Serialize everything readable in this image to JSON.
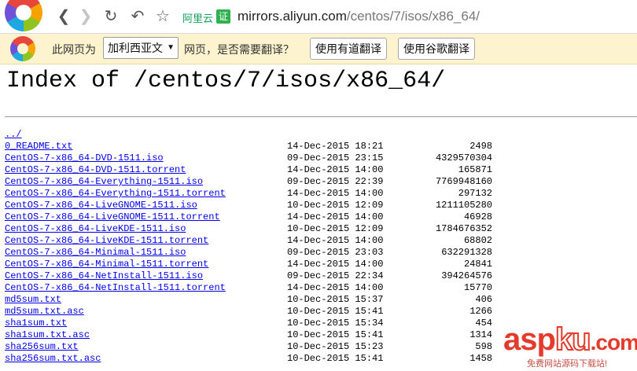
{
  "browser": {
    "url_badge": "阿里云",
    "url_host": "mirrors.aliyun.com",
    "url_path": "/centos/7/isos/x86_64/"
  },
  "translate_bar": {
    "prompt_prefix": "此网页为",
    "language": "加利西亚文",
    "prompt_suffix": "网页，是否需要翻译？",
    "youdao_button": "使用有道翻译",
    "google_button": "使用谷歌翻译"
  },
  "page": {
    "title": "Index of /centos/7/isos/x86_64/",
    "parent_link": "../",
    "entries": [
      {
        "name": "0_README.txt",
        "date": "14-Dec-2015 18:21",
        "size": "2498"
      },
      {
        "name": "CentOS-7-x86_64-DVD-1511.iso",
        "date": "09-Dec-2015 23:15",
        "size": "4329570304"
      },
      {
        "name": "CentOS-7-x86_64-DVD-1511.torrent",
        "date": "14-Dec-2015 14:00",
        "size": "165871"
      },
      {
        "name": "CentOS-7-x86_64-Everything-1511.iso",
        "date": "09-Dec-2015 22:39",
        "size": "7769948160"
      },
      {
        "name": "CentOS-7-x86_64-Everything-1511.torrent",
        "date": "14-Dec-2015 14:00",
        "size": "297132"
      },
      {
        "name": "CentOS-7-x86_64-LiveGNOME-1511.iso",
        "date": "10-Dec-2015 12:09",
        "size": "1211105280"
      },
      {
        "name": "CentOS-7-x86_64-LiveGNOME-1511.torrent",
        "date": "14-Dec-2015 14:00",
        "size": "46928"
      },
      {
        "name": "CentOS-7-x86_64-LiveKDE-1511.iso",
        "date": "10-Dec-2015 12:09",
        "size": "1784676352"
      },
      {
        "name": "CentOS-7-x86_64-LiveKDE-1511.torrent",
        "date": "14-Dec-2015 14:00",
        "size": "68802"
      },
      {
        "name": "CentOS-7-x86_64-Minimal-1511.iso",
        "date": "09-Dec-2015 23:03",
        "size": "632291328"
      },
      {
        "name": "CentOS-7-x86_64-Minimal-1511.torrent",
        "date": "14-Dec-2015 14:00",
        "size": "24841"
      },
      {
        "name": "CentOS-7-x86_64-NetInstall-1511.iso",
        "date": "09-Dec-2015 22:34",
        "size": "394264576"
      },
      {
        "name": "CentOS-7-x86_64-NetInstall-1511.torrent",
        "date": "14-Dec-2015 14:00",
        "size": "15770"
      },
      {
        "name": "md5sum.txt",
        "date": "10-Dec-2015 15:37",
        "size": "406"
      },
      {
        "name": "md5sum.txt.asc",
        "date": "10-Dec-2015 15:41",
        "size": "1266"
      },
      {
        "name": "sha1sum.txt",
        "date": "10-Dec-2015 15:34",
        "size": "454"
      },
      {
        "name": "sha1sum.txt.asc",
        "date": "10-Dec-2015 15:41",
        "size": "1314"
      },
      {
        "name": "sha256sum.txt",
        "date": "10-Dec-2015 15:23",
        "size": "598"
      },
      {
        "name": "sha256sum.txt.asc",
        "date": "10-Dec-2015 15:41",
        "size": "1458"
      }
    ]
  },
  "watermark": {
    "brand_a": "asp",
    "brand_b": "ku",
    "brand_c": ".com",
    "subtitle": "免费网站源码下载站!"
  }
}
